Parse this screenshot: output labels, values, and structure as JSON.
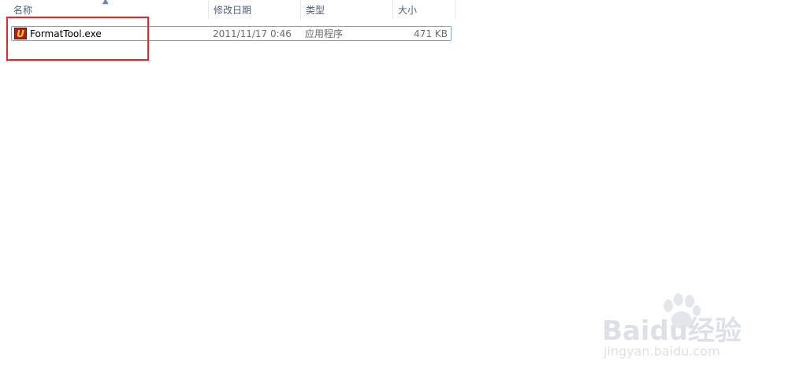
{
  "columns": {
    "name": "名称",
    "date_modified": "修改日期",
    "type": "类型",
    "size": "大小"
  },
  "sort": {
    "indicator_icon": "sort-ascending-icon",
    "column": "name"
  },
  "files": [
    {
      "icon": "app-exe-icon",
      "icon_letter": "U",
      "name": "FormatTool.exe",
      "date_modified": "2011/11/17 0:46",
      "type": "应用程序",
      "size": "471 KB"
    }
  ],
  "watermark": {
    "logo_text": "Baidu经验",
    "url": "jingyan.baidu.com"
  },
  "colors": {
    "highlight": "#e0282b",
    "selection_border": "#7da2ce",
    "header_text": "#4c607a",
    "icon_bg": "#b91c13",
    "icon_letter": "#ffd23a"
  }
}
